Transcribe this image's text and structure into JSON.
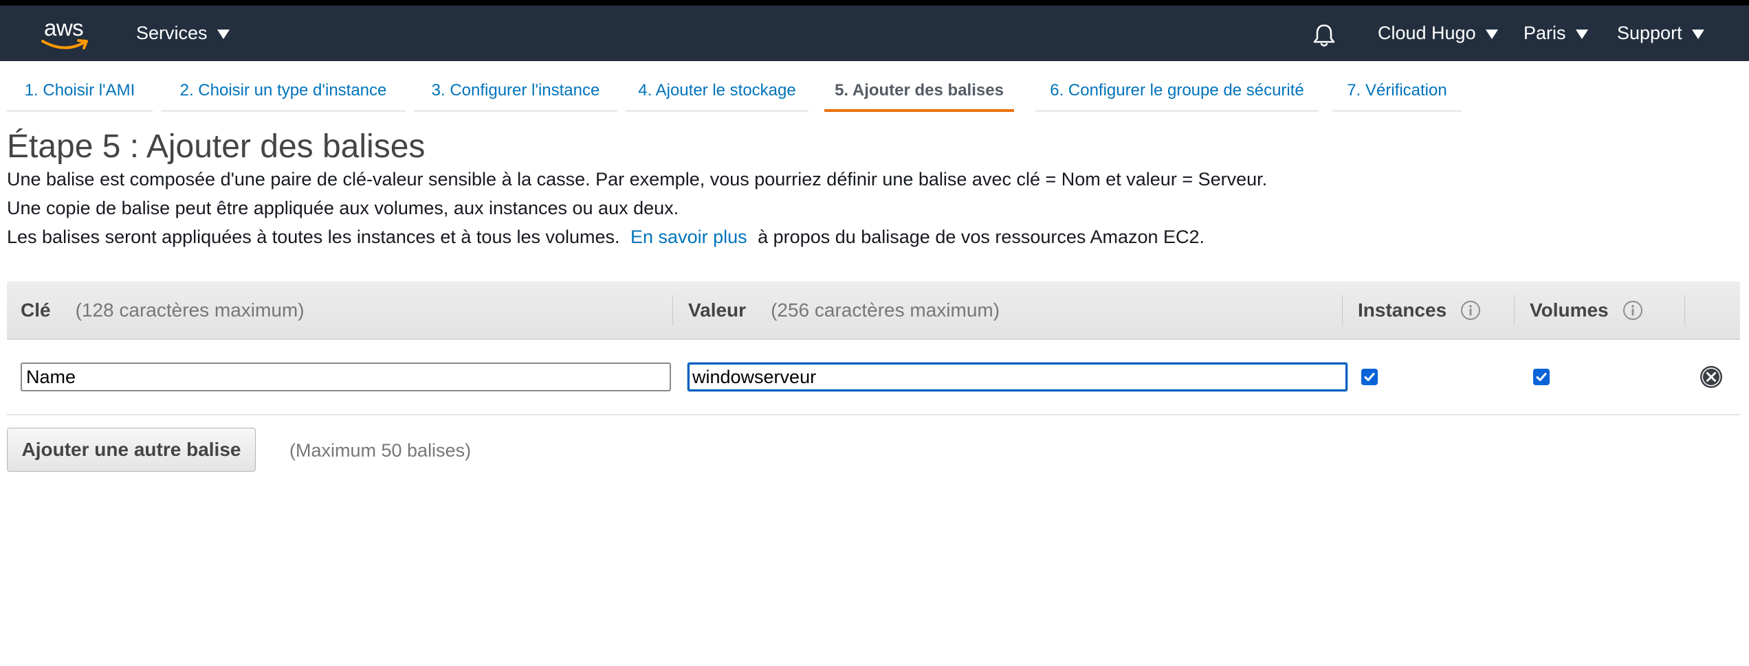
{
  "topnav": {
    "logo_text": "aws",
    "services_label": "Services",
    "account_label": "Cloud Hugo",
    "region_label": "Paris",
    "support_label": "Support",
    "brand_accent": "#ff9900",
    "background": "#232f3e"
  },
  "wizard": {
    "steps": [
      {
        "label": "1. Choisir l'AMI",
        "active": false
      },
      {
        "label": "2. Choisir un type d'instance",
        "active": false
      },
      {
        "label": "3. Configurer l'instance",
        "active": false
      },
      {
        "label": "4. Ajouter le stockage",
        "active": false
      },
      {
        "label": "5. Ajouter des balises",
        "active": true
      },
      {
        "label": "6. Configurer le groupe de sécurité",
        "active": false
      },
      {
        "label": "7. Vérification",
        "active": false
      }
    ],
    "active_color": "#ec7211",
    "link_color": "#0073bb"
  },
  "page": {
    "title": "Étape 5 : Ajouter des balises",
    "desc_line1": "Une balise est composée d'une paire de clé-valeur sensible à la casse. Par exemple, vous pourriez définir une balise avec clé = Nom et valeur = Serveur.",
    "desc_line2": "Une copie de balise peut être appliquée aux volumes, aux instances ou aux deux.",
    "desc_line3_prefix": "Les balises seront appliquées à toutes les instances et à tous les volumes.",
    "learn_more_link": "En savoir plus",
    "desc_line3_suffix": "à propos du balisage de vos ressources Amazon EC2."
  },
  "tags_table": {
    "headers": {
      "key_label": "Clé",
      "key_hint": "(128 caractères maximum)",
      "value_label": "Valeur",
      "value_hint": "(256 caractères maximum)",
      "instances_label": "Instances",
      "volumes_label": "Volumes"
    },
    "rows": [
      {
        "key": "Name",
        "value": "windowserveur",
        "instances": true,
        "volumes": true
      }
    ]
  },
  "actions": {
    "add_tag_label": "Ajouter une autre balise",
    "max_note": "(Maximum 50 balises)"
  }
}
